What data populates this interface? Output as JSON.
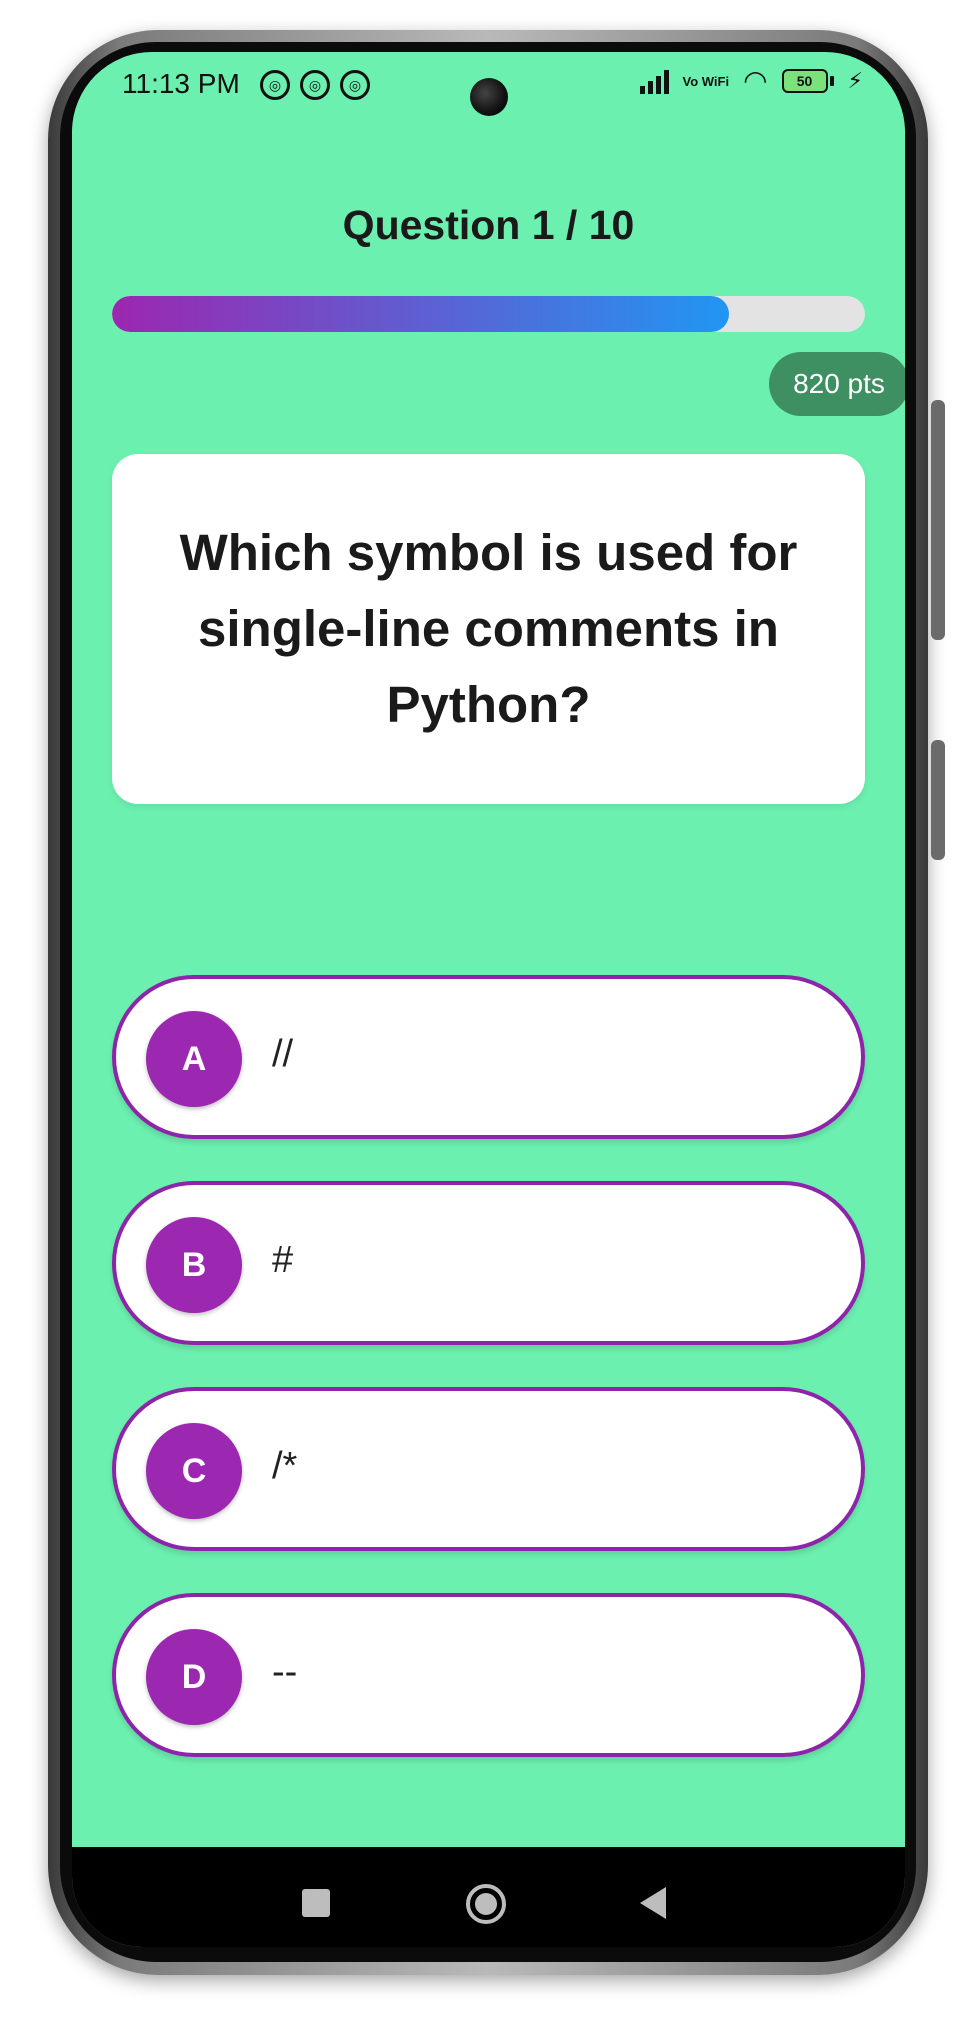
{
  "status_bar": {
    "time": "11:13 PM",
    "left_icons": [
      "notification-icon",
      "notification-icon",
      "notification-icon"
    ],
    "network_label": "Vo WiFi",
    "battery_level": "50",
    "charging_icon": "bolt-icon"
  },
  "quiz": {
    "counter": "Question 1 / 10",
    "progress_percent": 82,
    "points": "820 pts",
    "question": "Which symbol is used for single-line comments in Python?",
    "options": [
      {
        "letter": "A",
        "text": "//"
      },
      {
        "letter": "B",
        "text": "#"
      },
      {
        "letter": "C",
        "text": "/*"
      },
      {
        "letter": "D",
        "text": "--"
      }
    ]
  },
  "navigation": {
    "icons": [
      "recent-apps-icon",
      "home-icon",
      "back-icon"
    ]
  },
  "colors": {
    "background": "#6cf0b0",
    "accent": "#9c27b0",
    "progress_end": "#2196f3",
    "points_badge": "#3e8f61"
  }
}
